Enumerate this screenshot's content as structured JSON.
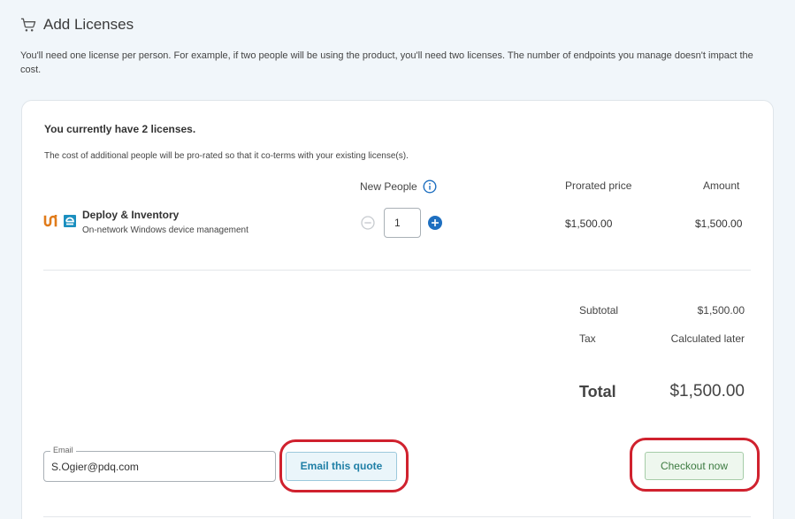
{
  "header": {
    "title": "Add Licenses",
    "icon": "cart-icon"
  },
  "intro": "You'll need one license per person. For example, if two people will be using the product, you'll need two licenses. The number of endpoints you manage doesn't impact the cost.",
  "card": {
    "current": "You currently have 2 licenses.",
    "prorate_note": "The cost of additional people will be pro-rated so that it co-terms with your existing license(s).",
    "columns": {
      "new_people": "New People",
      "prorated_price": "Prorated price",
      "amount": "Amount"
    },
    "product": {
      "name": "Deploy & Inventory",
      "description": "On-network Windows device management",
      "quantity": "1",
      "prorated_price": "$1,500.00",
      "amount": "$1,500.00"
    },
    "summary": {
      "subtotal_label": "Subtotal",
      "subtotal_value": "$1,500.00",
      "tax_label": "Tax",
      "tax_value": "Calculated later",
      "total_label": "Total",
      "total_value": "$1,500.00"
    },
    "email": {
      "legend": "Email",
      "value": "S.Ogier@pdq.com"
    },
    "buttons": {
      "email_quote": "Email this quote",
      "checkout": "Checkout now"
    }
  },
  "colors": {
    "page_bg": "#f1f6fa",
    "accent_blue": "#1f7fa6",
    "checkout_green": "#3d7b41",
    "highlight_red": "#d0212e",
    "deploy_orange": "#e07b1a",
    "inventory_teal": "#1b8fbf"
  }
}
